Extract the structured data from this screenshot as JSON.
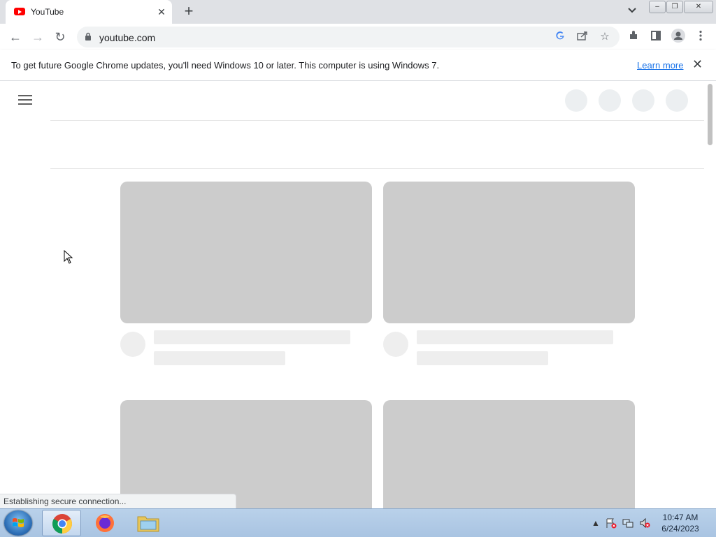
{
  "browser": {
    "tab": {
      "title": "YouTube",
      "close_glyph": "✕"
    },
    "new_tab_glyph": "+",
    "tab_search_glyph": "⌄",
    "window_controls": {
      "minimize": "‒",
      "restore": "❐",
      "close": "✕"
    },
    "toolbar": {
      "back_glyph": "←",
      "forward_glyph": "→",
      "reload_glyph": "↻",
      "url": "youtube.com",
      "icons": [
        "google-lens-icon",
        "share-icon",
        "bookmark-star-icon",
        "extensions-icon",
        "side-panel-icon",
        "profile-icon",
        "menu-kebab-icon"
      ]
    },
    "infobar": {
      "message": "To get future Google Chrome updates, you'll need Windows 10 or later. This computer is using Windows 7.",
      "link": "Learn more",
      "close_glyph": "✕"
    },
    "status_bubble": "Establishing secure connection..."
  },
  "page": {
    "skeleton_header_circles": 4,
    "skeleton_cards": 4
  },
  "taskbar": {
    "items": [
      "start-button",
      "chrome",
      "firefox",
      "file-explorer"
    ],
    "clock": {
      "time": "10:47 AM",
      "date": "6/24/2023"
    }
  },
  "colors": {
    "youtube_red": "#ff0000",
    "skeleton_thumb": "#cccccc",
    "skeleton_light": "#eeeeee",
    "link_blue": "#1a73e8"
  }
}
